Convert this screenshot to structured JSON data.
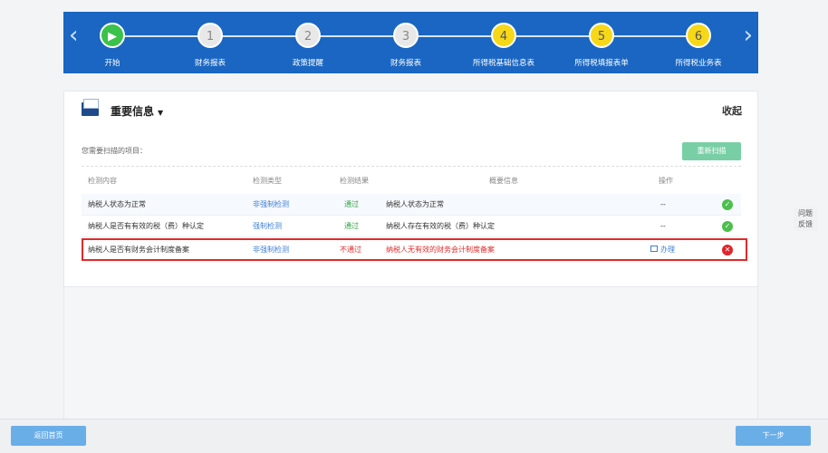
{
  "steps": [
    {
      "num": "▶",
      "label": "开始"
    },
    {
      "num": "1",
      "label": "财务报表"
    },
    {
      "num": "2",
      "label": "政策提醒"
    },
    {
      "num": "3",
      "label": "财务报表"
    },
    {
      "num": "4",
      "label": "所得税基础信息表"
    },
    {
      "num": "5",
      "label": "所得税填报表单"
    },
    {
      "num": "6",
      "label": "所得税业务表"
    }
  ],
  "colors": {
    "header": "#1a66c2",
    "active_step": "#3ac24a",
    "pending_step": "#f7d819",
    "error": "#e02a2a",
    "pass": "#33a34a",
    "link": "#3f7fd6"
  },
  "panel": {
    "title": "重要信息",
    "collapse": "收起",
    "subtitle": "您需要扫描的项目：",
    "rescan": "重新扫描"
  },
  "table": {
    "headers": [
      "检测内容",
      "检测类型",
      "检测结果",
      "概要信息",
      "操作"
    ],
    "rows": [
      {
        "item": "纳税人状态为正常",
        "type": "非强制检测",
        "result": "通过",
        "summary": "纳税人状态为正常",
        "action": "--",
        "status": "pass"
      },
      {
        "item": "纳税人是否有有效的税（费）种认定",
        "type": "强制检测",
        "result": "通过",
        "summary": "纳税人存在有效的税（费）种认定",
        "action": "--",
        "status": "pass"
      },
      {
        "item": "纳税人是否有财务会计制度备案",
        "type": "非强制检测",
        "result": "不通过",
        "summary": "纳税人无有效的财务会计制度备案",
        "action": "办理",
        "status": "fail"
      }
    ]
  },
  "feedback": [
    "问题",
    "反馈"
  ],
  "footer": {
    "back": "返回首页",
    "next": "下一步"
  }
}
